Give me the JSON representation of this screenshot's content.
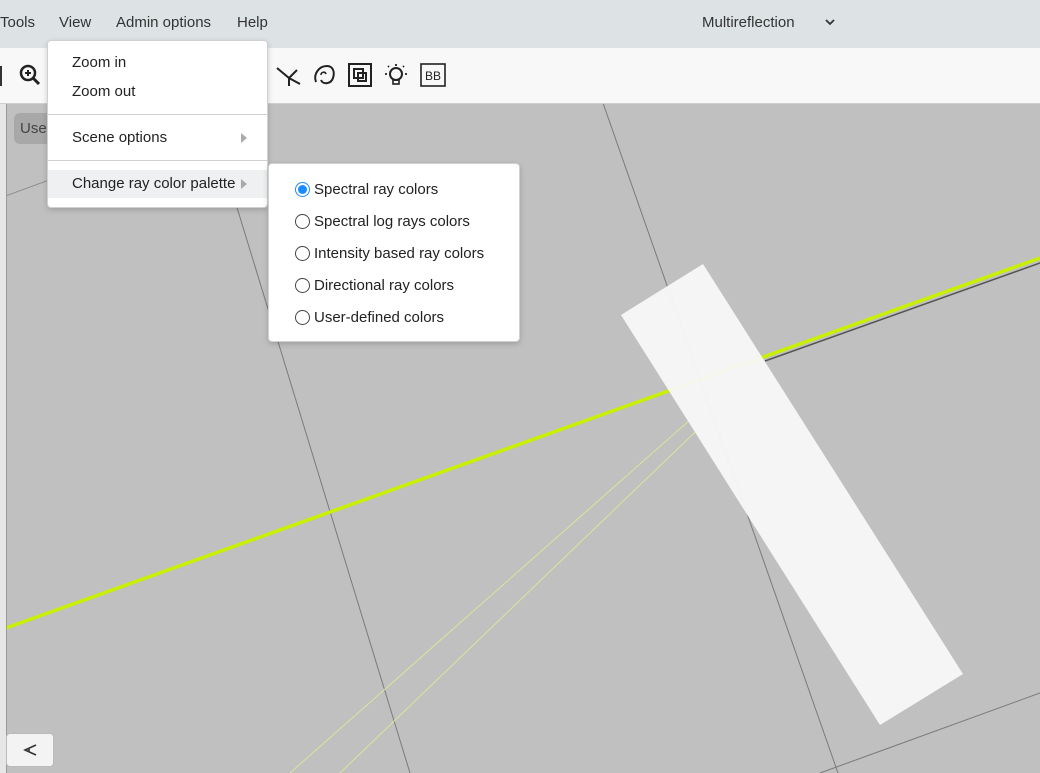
{
  "menubar": {
    "items": [
      "Tools",
      "View",
      "Admin options",
      "Help"
    ],
    "mode_select": "Multireflection"
  },
  "toolbar": {
    "icons": [
      "zoom-in-icon",
      "ray-source-icon",
      "curved-mirror-icon",
      "blocker-icon",
      "lamp-icon",
      "bb-icon"
    ],
    "bb_label": "BB"
  },
  "canvas": {
    "user_chip": "Use"
  },
  "view_menu": {
    "items": [
      {
        "label": "Zoom in"
      },
      {
        "label": "Zoom out"
      },
      {
        "label": "Scene options"
      },
      {
        "label": "Change ray color palette"
      }
    ]
  },
  "palette_menu": {
    "options": [
      {
        "label": "Spectral ray colors",
        "checked": true
      },
      {
        "label": "Spectral log rays colors",
        "checked": false
      },
      {
        "label": "Intensity based ray colors",
        "checked": false
      },
      {
        "label": "Directional ray colors",
        "checked": false
      },
      {
        "label": "User-defined colors",
        "checked": false
      }
    ]
  },
  "colors": {
    "ray": "#c8f000",
    "accent": "#1a8cff",
    "canvas_bg": "#c0c0c0"
  }
}
